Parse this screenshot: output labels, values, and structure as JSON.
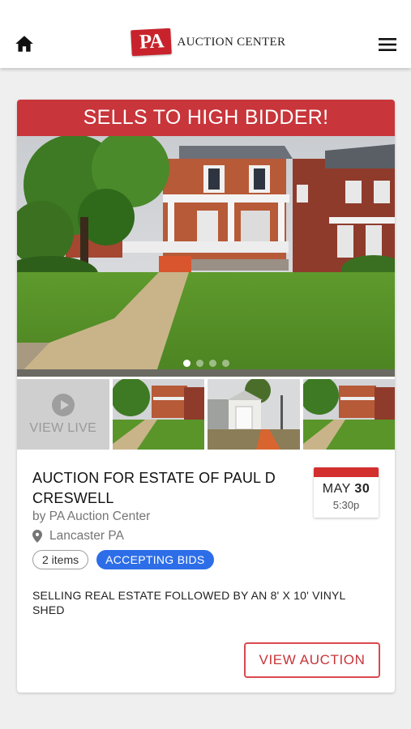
{
  "header": {
    "logo_badge": "PA",
    "logo_text": "AUCTION CENTER",
    "home_icon": "home-icon",
    "menu_icon": "menu-icon"
  },
  "listing": {
    "banner": "SELLS TO HIGH BIDDER!",
    "carousel": {
      "slides": 4,
      "active_index": 0
    },
    "live_label": "VIEW LIVE",
    "title": "AUCTION FOR ESTATE OF PAUL D CRESWELL",
    "byline": "by PA Auction Center",
    "location": "Lancaster PA",
    "date": {
      "month": "MAY",
      "day": "30",
      "time": "5:30p"
    },
    "items_count": "2 items",
    "status": "ACCEPTING BIDS",
    "description": "SELLING REAL ESTATE FOLLOWED BY AN 8' X 10' VINYL SHED",
    "cta": "VIEW AUCTION"
  },
  "colors": {
    "brand_red": "#c8353a",
    "status_blue": "#2d6ee8",
    "background": "#efefef"
  }
}
